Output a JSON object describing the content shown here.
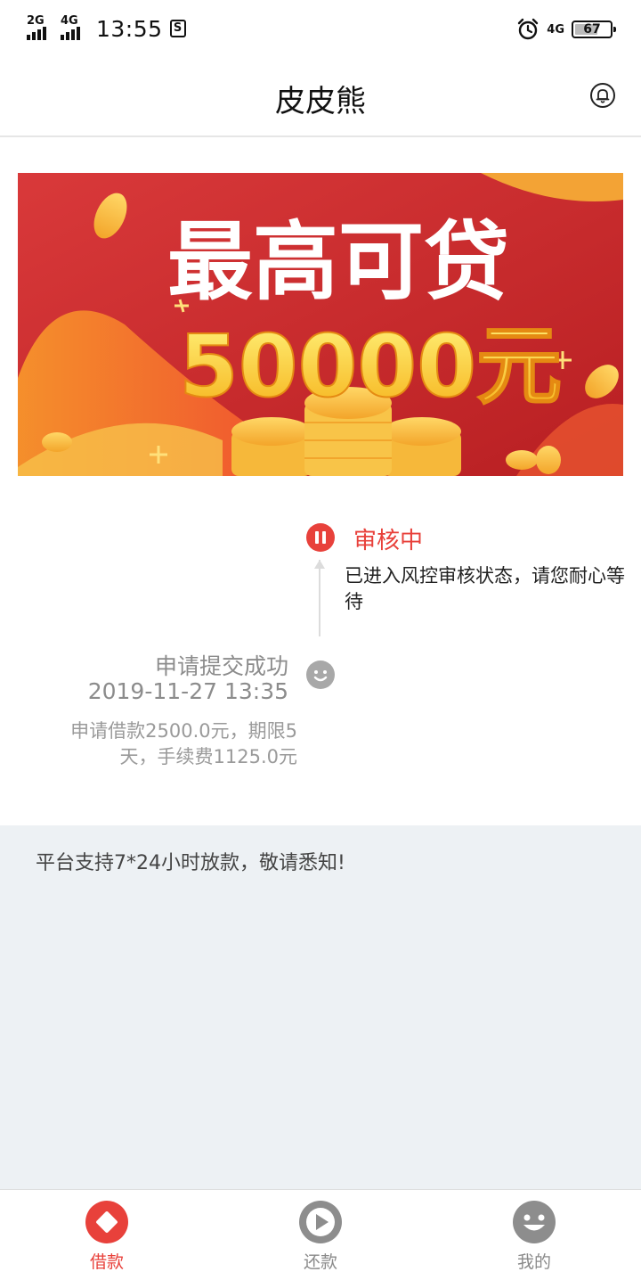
{
  "status_bar": {
    "net1": "2G",
    "net2": "4G",
    "time": "13:55",
    "s_badge": "S",
    "net3": "4G",
    "battery": "67",
    "battery_level": 0.67
  },
  "header": {
    "title": "皮皮熊"
  },
  "banner": {
    "line1": "最高可贷",
    "line2": "50000元"
  },
  "timeline": {
    "current": {
      "title": "审核中",
      "desc": "已进入风控审核状态，请您耐心等待",
      "color": "#e8413b"
    },
    "previous": {
      "title": "申请提交成功",
      "time": "2019-11-27 13:35",
      "detail": "申请借款2500.0元，期限5天，手续费1125.0元"
    }
  },
  "notice": "平台支持7*24小时放款，敬请悉知!",
  "tabs": [
    {
      "label": "借款",
      "icon": "loan-diamond-icon",
      "active": true
    },
    {
      "label": "还款",
      "icon": "repay-play-icon",
      "active": false
    },
    {
      "label": "我的",
      "icon": "profile-smile-icon",
      "active": false
    }
  ],
  "colors": {
    "accent": "#e8413b",
    "muted": "#8a8a8a",
    "notice_bg": "#edf1f4"
  }
}
